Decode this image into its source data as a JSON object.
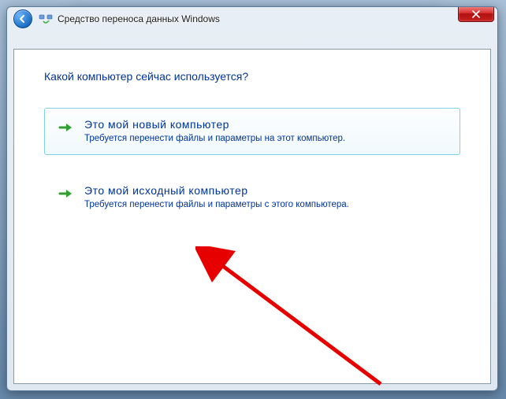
{
  "window": {
    "title": "Средство переноса данных Windows"
  },
  "content": {
    "heading": "Какой компьютер сейчас используется?",
    "options": [
      {
        "title": "Это мой новый компьютер",
        "description": "Требуется перенести файлы и параметры на этот компьютер."
      },
      {
        "title": "Это мой исходный компьютер",
        "description": "Требуется перенести файлы и параметры с этого компьютера."
      }
    ]
  }
}
